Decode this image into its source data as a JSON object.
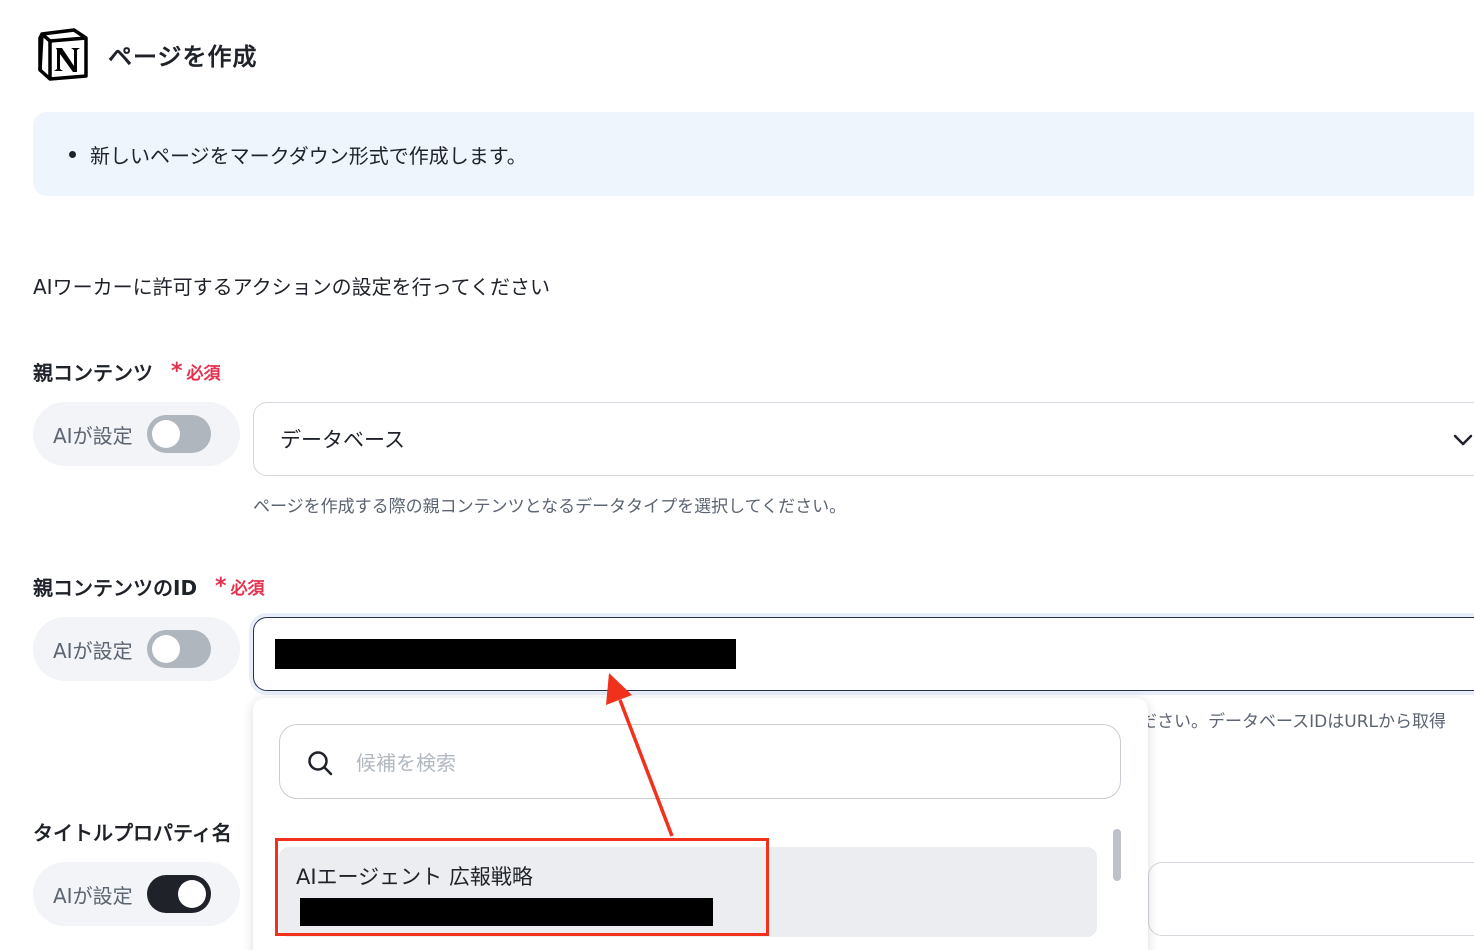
{
  "header": {
    "title": "ページを作成",
    "logo_icon": "notion-logo-icon"
  },
  "info": {
    "bullet_text": "新しいページをマークダウン形式で作成します。"
  },
  "instruction": "AIワーカーに許可するアクションの設定を行ってください",
  "required_label": "必須",
  "ai_toggle_label": "AIが設定",
  "fields": {
    "parent_content": {
      "label": "親コンテンツ",
      "value": "データベース",
      "hint": "ページを作成する際の親コンテンツとなるデータタイプを選択してください。",
      "ai_enabled": false
    },
    "parent_content_id": {
      "label": "親コンテンツのID",
      "hint_tail": "ださい。データベースIDはURLから取得",
      "ai_enabled": false
    },
    "title_property": {
      "label": "タイトルプロパティ名",
      "ai_enabled": true
    }
  },
  "dropdown": {
    "search_placeholder": "候補を検索",
    "options": [
      {
        "title": "AIエージェント 広報戦略"
      }
    ]
  },
  "colors": {
    "accent_red": "#f2311c",
    "required_red": "#e5314f",
    "info_bg": "#eef5fc",
    "toggle_on": "#1f2329",
    "toggle_off": "#b0b6bd"
  }
}
